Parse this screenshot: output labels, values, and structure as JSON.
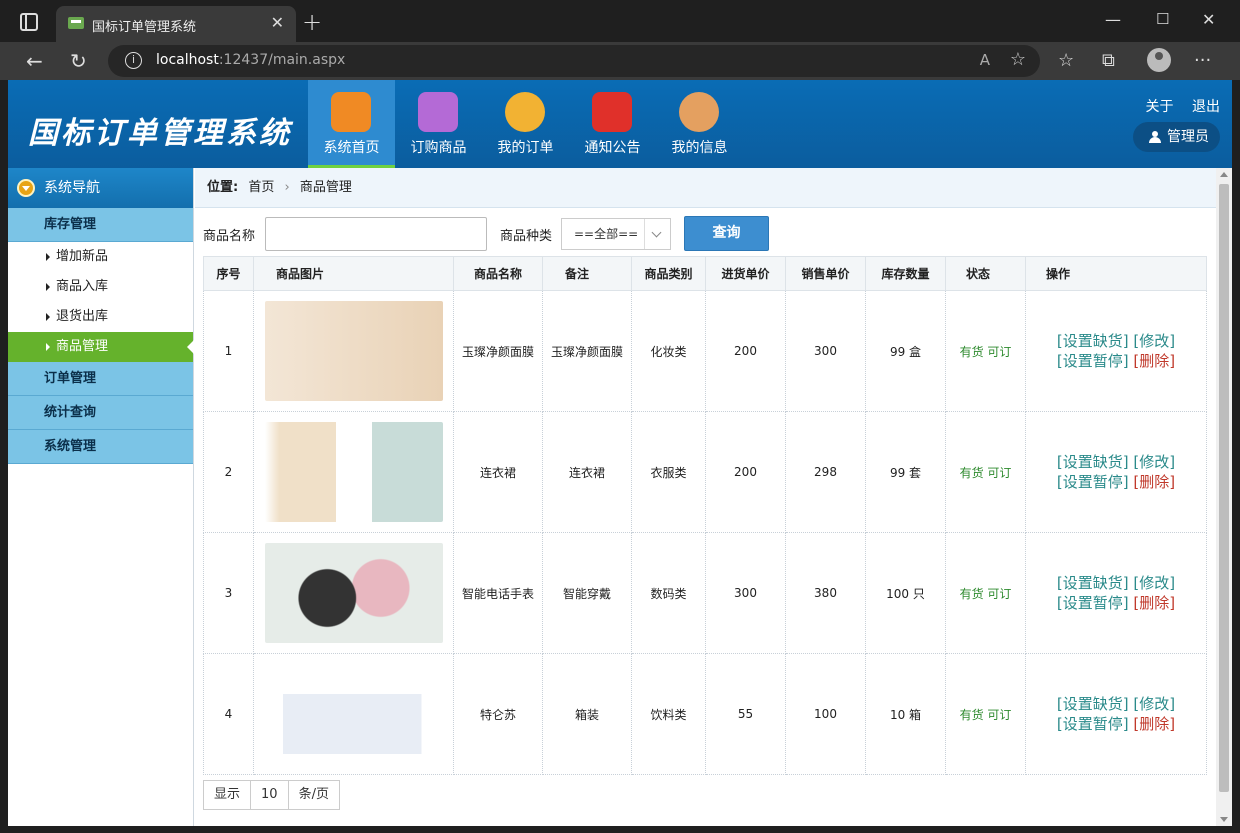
{
  "browser": {
    "tab_title": "国标订单管理系统",
    "url_host": "localhost",
    "url_rest": ":12437/main.aspx",
    "reader_label": "A"
  },
  "header": {
    "logo": "国标订单管理系统",
    "menu": [
      {
        "label": "系统首页",
        "icon": "home-icon",
        "color": "#f08a24"
      },
      {
        "label": "订购商品",
        "icon": "phone-cart-icon",
        "color": "#b46ad6"
      },
      {
        "label": "我的订单",
        "icon": "dish-icon",
        "color": "#f2b233"
      },
      {
        "label": "通知公告",
        "icon": "megaphone-icon",
        "color": "#e0302a"
      },
      {
        "label": "我的信息",
        "icon": "user-icon",
        "color": "#e4a060"
      }
    ],
    "about": "关于",
    "logout": "退出",
    "admin": "管理员"
  },
  "sidebar": {
    "title": "系统导航",
    "group_inventory": "库存管理",
    "items": [
      "增加新品",
      "商品入库",
      "退货出库",
      "商品管理"
    ],
    "group_orders": "订单管理",
    "group_stats": "统计查询",
    "group_system": "系统管理"
  },
  "breadcrumb": {
    "label": "位置:",
    "home": "首页",
    "current": "商品管理"
  },
  "search": {
    "name_label": "商品名称",
    "name_value": "",
    "type_label": "商品种类",
    "type_value": "==全部==",
    "button": "查询"
  },
  "table": {
    "headers": [
      "序号",
      "商品图片",
      "商品名称",
      "备注",
      "商品类别",
      "进货单价",
      "销售单价",
      "库存数量",
      "状态",
      "操作"
    ],
    "rows": [
      {
        "no": "1",
        "name": "玉璨净颜面膜",
        "note": "玉璨净颜面膜",
        "category": "化妆类",
        "cost": "200",
        "price": "300",
        "stock": "99 盒",
        "status": "有货 可订",
        "image": "cosmetic-tube-image"
      },
      {
        "no": "2",
        "name": "连衣裙",
        "note": "连衣裙",
        "category": "衣服类",
        "cost": "200",
        "price": "298",
        "stock": "99 套",
        "status": "有货 可订",
        "image": "dress-image"
      },
      {
        "no": "3",
        "name": "智能电话手表",
        "note": "智能穿戴",
        "category": "数码类",
        "cost": "300",
        "price": "380",
        "stock": "100 只",
        "status": "有货 可订",
        "image": "smartwatch-image"
      },
      {
        "no": "4",
        "name": "特仑苏",
        "note": "箱装",
        "category": "饮料类",
        "cost": "55",
        "price": "100",
        "stock": "10 箱",
        "status": "有货 可订",
        "image": "milk-box-image"
      }
    ],
    "ops": {
      "set_short": "[设置缺货]",
      "edit": "[修改]",
      "set_pause": "[设置暂停]",
      "delete": "[删除]"
    }
  },
  "pager": {
    "show": "显示",
    "size": "10",
    "unit": "条/页"
  }
}
